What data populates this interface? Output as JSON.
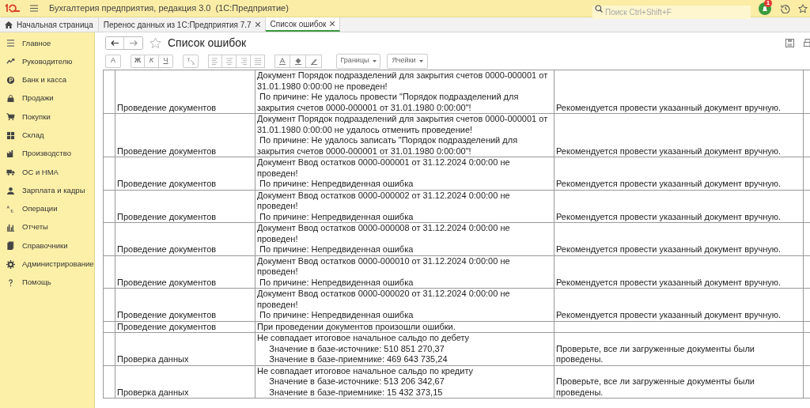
{
  "window": {
    "title": "Бухгалтерия предприятия, редакция 3.0  (1С:Предприятие)"
  },
  "search": {
    "placeholder": "Поиск Ctrl+Shift+F"
  },
  "notifications": {
    "count": "1"
  },
  "tabs": [
    {
      "label": "Начальная страница",
      "kind": "home",
      "selected": false
    },
    {
      "label": "Перенос данных из 1С:Предприятия 7.7",
      "kind": "closable",
      "selected": false
    },
    {
      "label": "Список ошибок",
      "kind": "closable",
      "selected": true
    }
  ],
  "sidebar": {
    "items": [
      {
        "label": "Главное"
      },
      {
        "label": "Руководителю"
      },
      {
        "label": "Банк и касса"
      },
      {
        "label": "Продажи"
      },
      {
        "label": "Покупки"
      },
      {
        "label": "Склад"
      },
      {
        "label": "Производство"
      },
      {
        "label": "ОС и НМА"
      },
      {
        "label": "Зарплата и кадры"
      },
      {
        "label": "Операции"
      },
      {
        "label": "Отчеты"
      },
      {
        "label": "Справочники"
      },
      {
        "label": "Администрирование"
      },
      {
        "label": "Помощь"
      }
    ]
  },
  "form": {
    "title": "Список ошибок",
    "toolbar": {
      "font_button": "A",
      "bold_button": "Ж",
      "italic_button": "К",
      "underline_button": "Ч",
      "borders_menu": "Границы",
      "cells_menu": "Ячейки"
    }
  },
  "table": {
    "rows": [
      {
        "category": "Проведение документов",
        "message": "Документ Порядок подразделений для закрытия счетов 0000-000001 от\n31.01.1980 0:00:00 не проведен!\n По причине: Не удалось провести \"Порядок подразделений для\nзакрытия счетов 0000-000001 от 31.01.1980 0:00:00\"!",
        "recommendation": "Рекомендуется провести указанный документ вручную."
      },
      {
        "category": "Проведение документов",
        "message": "Документ Порядок подразделений для закрытия счетов 0000-000001 от\n31.01.1980 0:00:00 не удалось отменить проведение!\n По причине: Не удалось записать \"Порядок подразделений для\nзакрытия счетов 0000-000001 от 31.01.1980 0:00:00\"!",
        "recommendation": "Рекомендуется провести указанный документ вручную."
      },
      {
        "category": "Проведение документов",
        "message": "Документ Ввод остатков 0000-000001 от 31.12.2024 0:00:00 не\nпроведен!\n По причине: Непредвиденная ошибка",
        "recommendation": "Рекомендуется провести указанный документ вручную."
      },
      {
        "category": "Проведение документов",
        "message": "Документ Ввод остатков 0000-000002 от 31.12.2024 0:00:00 не\nпроведен!\n По причине: Непредвиденная ошибка",
        "recommendation": "Рекомендуется провести указанный документ вручную."
      },
      {
        "category": "Проведение документов",
        "message": "Документ Ввод остатков 0000-000008 от 31.12.2024 0:00:00 не\nпроведен!\n По причине: Непредвиденная ошибка",
        "recommendation": "Рекомендуется провести указанный документ вручную."
      },
      {
        "category": "Проведение документов",
        "message": "Документ Ввод остатков 0000-000010 от 31.12.2024 0:00:00 не\nпроведен!\n По причине: Непредвиденная ошибка",
        "recommendation": "Рекомендуется провести указанный документ вручную."
      },
      {
        "category": "Проведение документов",
        "message": "Документ Ввод остатков 0000-000020 от 31.12.2024 0:00:00 не\nпроведен!\n По причине: Непредвиденная ошибка",
        "recommendation": "Рекомендуется провести указанный документ вручную."
      },
      {
        "category": "Проведение документов",
        "message": "При проведении документов произошли ошибки."
      },
      {
        "category": "Проверка данных",
        "message": "Не совпадает итоговое начальное сальдо по дебету\n     Значение в базе-источнике: 510 851 270,37\n     Значение в базе-приемнике: 469 643 735,24",
        "recommendation": "Проверьте, все ли загруженные документы были\nпроведены."
      },
      {
        "category": "Проверка данных",
        "message": "Не совпадает итоговое начальное сальдо по кредиту\n     Значение в базе-источнике: 513 206 342,67\n     Значение в базе-приемнике: 15 432 373,15",
        "recommendation": "Проверьте, все ли загруженные документы были\nпроведены."
      }
    ]
  }
}
